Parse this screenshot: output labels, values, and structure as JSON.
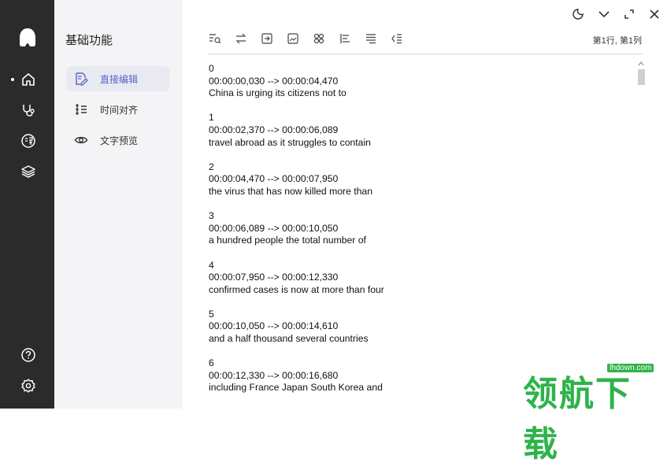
{
  "app": {
    "cursor_position": "第1行, 第1列"
  },
  "rail": {
    "items": [
      {
        "name": "home",
        "icon": "home-icon"
      },
      {
        "name": "stethoscope",
        "icon": "stethoscope-icon"
      },
      {
        "name": "translate",
        "icon": "translate-icon"
      },
      {
        "name": "layers",
        "icon": "layers-icon"
      },
      {
        "name": "help",
        "icon": "help-icon"
      },
      {
        "name": "settings",
        "icon": "gear-icon"
      }
    ]
  },
  "sidebar": {
    "title": "基础功能",
    "items": [
      {
        "label": "直接编辑",
        "icon": "edit-icon",
        "active": true
      },
      {
        "label": "时间对齐",
        "icon": "align-icon",
        "active": false
      },
      {
        "label": "文字预览",
        "icon": "eye-icon",
        "active": false
      }
    ]
  },
  "toolbar": {
    "buttons": [
      "find-replace-icon",
      "swap-icon",
      "insert-icon",
      "image-icon",
      "grid-icon",
      "align-left-icon",
      "align-justify-icon",
      "outdent-icon"
    ]
  },
  "window_controls": [
    "theme-icon",
    "minimize-icon",
    "maximize-icon",
    "close-icon"
  ],
  "editor": {
    "entries": [
      {
        "index": "0",
        "time": "00:00:00,030 --> 00:00:04,470",
        "text": "China is urging its citizens not to"
      },
      {
        "index": "1",
        "time": "00:00:02,370 --> 00:00:06,089",
        "text": "travel abroad as it struggles to contain"
      },
      {
        "index": "2",
        "time": "00:00:04,470 --> 00:00:07,950",
        "text": "the virus that has now killed more than"
      },
      {
        "index": "3",
        "time": "00:00:06,089 --> 00:00:10,050",
        "text": "a hundred people the total number of"
      },
      {
        "index": "4",
        "time": "00:00:07,950 --> 00:00:12,330",
        "text": "confirmed cases is now at more than four"
      },
      {
        "index": "5",
        "time": "00:00:10,050 --> 00:00:14,610",
        "text": "and a half thousand several countries"
      },
      {
        "index": "6",
        "time": "00:00:12,330 --> 00:00:16,680",
        "text": "including France Japan South Korea and"
      }
    ]
  },
  "watermark": {
    "text": "领航下载",
    "url": "lhdown.com"
  },
  "colors": {
    "accent": "#5a63c8",
    "rail": "#2b2b2b",
    "sidebar": "#f4f4f6",
    "watermark": "#2fb34a"
  }
}
